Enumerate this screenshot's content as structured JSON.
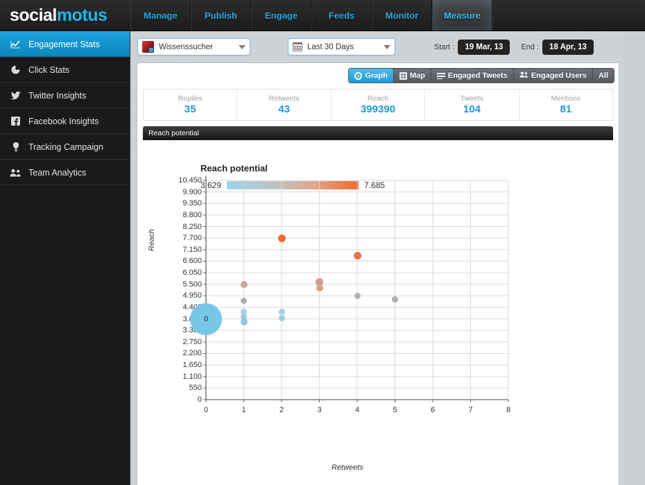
{
  "brand": {
    "part1": "social",
    "part2": "motus"
  },
  "topnav": {
    "items": [
      {
        "label": "Manage",
        "active": false
      },
      {
        "label": "Publish",
        "active": false
      },
      {
        "label": "Engage",
        "active": false
      },
      {
        "label": "Feeds",
        "active": false
      },
      {
        "label": "Monitor",
        "active": false
      },
      {
        "label": "Measure",
        "active": true
      }
    ]
  },
  "sidebar": {
    "items": [
      {
        "label": "Engagement Stats",
        "icon": "line-chart-icon",
        "glyph": "↗",
        "active": true
      },
      {
        "label": "Click Stats",
        "icon": "pie-chart-icon",
        "glyph": "◕",
        "active": false
      },
      {
        "label": "Twitter Insights",
        "icon": "twitter-bird-icon",
        "glyph": "ὂ6",
        "active": false
      },
      {
        "label": "Facebook Insights",
        "icon": "facebook-icon",
        "glyph": "f",
        "active": false
      },
      {
        "label": "Tracking Campaign",
        "icon": "lightbulb-icon",
        "glyph": "●",
        "active": false
      },
      {
        "label": "Team Analytics",
        "icon": "people-icon",
        "glyph": "♟",
        "active": false
      }
    ]
  },
  "toolbar": {
    "account": {
      "label": "Wissenssucher",
      "icon": "account-avatar-icon"
    },
    "date_range": {
      "label": "Last 30 Days",
      "icon": "calendar-icon"
    },
    "start_label": "Start :",
    "start_value": "19 Mar, 13",
    "end_label": "End :",
    "end_value": "18 Apr, 13"
  },
  "view_tabs": [
    {
      "label": "Graph",
      "icon": "graph-icon",
      "active": true
    },
    {
      "label": "Map",
      "icon": "map-icon",
      "active": false
    },
    {
      "label": "Engaged Tweets",
      "icon": "tweets-icon",
      "active": false
    },
    {
      "label": "Engaged Users",
      "icon": "users-icon",
      "active": false
    },
    {
      "label": "All",
      "icon": "",
      "active": false
    }
  ],
  "stats": [
    {
      "title": "Replies",
      "value": "35"
    },
    {
      "title": "Retweets",
      "value": "43"
    },
    {
      "title": "Reach",
      "value": "399390"
    },
    {
      "title": "Tweets",
      "value": "104"
    },
    {
      "title": "Mentions",
      "value": "81"
    }
  ],
  "panel": {
    "header": "Reach potential"
  },
  "colors": {
    "accent": "#1b9ad9",
    "sidebar_active": "#1ba3dd",
    "gradient_low": "#9ed4ea",
    "gradient_high": "#f2662a",
    "bubble": "#79c7e8"
  },
  "chart_data": {
    "type": "scatter",
    "title": "Reach potential",
    "xlabel": "Retweets",
    "ylabel": "Reach",
    "xlim": [
      0,
      8
    ],
    "ylim": [
      0,
      10450
    ],
    "xticks": [
      0,
      1,
      2,
      3,
      4,
      5,
      6,
      7,
      8
    ],
    "yticks": [
      0,
      550,
      1100,
      1650,
      2200,
      2750,
      3300,
      3850,
      4400,
      4950,
      5500,
      6050,
      6600,
      7150,
      7700,
      8250,
      8800,
      9350,
      9900,
      10450
    ],
    "ytick_labels": [
      "0",
      "550",
      "1.100",
      "1.650",
      "2.200",
      "2.750",
      "3.300",
      "3.850",
      "4.400",
      "4.950",
      "5.500",
      "6.050",
      "6.600",
      "7.150",
      "7.700",
      "8.250",
      "8.800",
      "9.350",
      "9.900",
      "10.450"
    ],
    "grid": true,
    "legend": {
      "title": "Reach potential",
      "min": "3.629",
      "max": "7.685",
      "type": "color-gradient"
    },
    "points": [
      {
        "x": 0,
        "y": 3850,
        "size": 46,
        "color": "#79c7e8",
        "label": "0"
      },
      {
        "x": 1,
        "y": 5500,
        "size": 10,
        "color": "#cfa39a"
      },
      {
        "x": 1,
        "y": 4720,
        "size": 9,
        "color": "#b0b0b0"
      },
      {
        "x": 1,
        "y": 4170,
        "size": 9,
        "color": "#a8cfe4"
      },
      {
        "x": 1,
        "y": 3940,
        "size": 9,
        "color": "#9ecbe3"
      },
      {
        "x": 1,
        "y": 3700,
        "size": 10,
        "color": "#8fc6e3"
      },
      {
        "x": 2,
        "y": 7700,
        "size": 11,
        "color": "#ee6c30"
      },
      {
        "x": 2,
        "y": 4170,
        "size": 9,
        "color": "#a3cde4"
      },
      {
        "x": 2,
        "y": 3900,
        "size": 9,
        "color": "#9ecbe3"
      },
      {
        "x": 3,
        "y": 5620,
        "size": 11,
        "color": "#d39a87"
      },
      {
        "x": 3,
        "y": 5320,
        "size": 10,
        "color": "#d6a091"
      },
      {
        "x": 4,
        "y": 6850,
        "size": 11,
        "color": "#e8714a"
      },
      {
        "x": 4,
        "y": 4950,
        "size": 9,
        "color": "#b0b0b0"
      },
      {
        "x": 5,
        "y": 4790,
        "size": 9,
        "color": "#b0b0b0"
      }
    ]
  }
}
